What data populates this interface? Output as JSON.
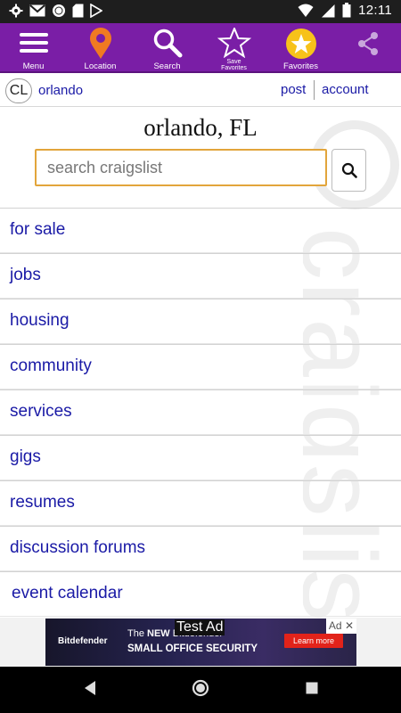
{
  "status_bar": {
    "time": "12:11",
    "left_icons": [
      "gear-icon",
      "gmail-icon",
      "circle-icon",
      "sd-card-icon",
      "play-store-icon"
    ],
    "right_icons": [
      "wifi-icon",
      "signal-icon",
      "battery-icon"
    ]
  },
  "toolbar": {
    "items": [
      {
        "label": "Menu",
        "icon": "hamburger-icon"
      },
      {
        "label": "Location",
        "icon": "location-pin-icon",
        "color": "#f07a22"
      },
      {
        "label": "Search",
        "icon": "magnifier-icon"
      },
      {
        "label": "Save Favorites",
        "icon": "star-outline-icon"
      },
      {
        "label": "Favorites",
        "icon": "star-filled-icon",
        "color": "#f7c21a"
      },
      {
        "label": "",
        "icon": "share-icon"
      }
    ],
    "background": "#7a1ea6"
  },
  "header": {
    "badge": "CL",
    "location": "orlando",
    "post": "post",
    "account": "account"
  },
  "main": {
    "city_title": "orlando, FL",
    "search_placeholder": "search craigslist",
    "search_border_color": "#e2a53b"
  },
  "watermark": {
    "text": "craigslist"
  },
  "categories": [
    "for sale",
    "jobs",
    "housing",
    "community",
    "services",
    "gigs",
    "resumes",
    "discussion forums",
    "event calendar"
  ],
  "ad": {
    "test_label": "Test Ad",
    "ad_tag": "Ad",
    "close": "✕",
    "brand": "Bitdefender",
    "line1_prefix": "The",
    "line1_bold": "NEW",
    "line1_rest": "Bitdefender",
    "line2": "SMALL OFFICE SECURITY",
    "cta": "Learn more"
  },
  "nav_bar": {
    "buttons": [
      "back-icon",
      "home-icon",
      "recents-icon"
    ]
  }
}
